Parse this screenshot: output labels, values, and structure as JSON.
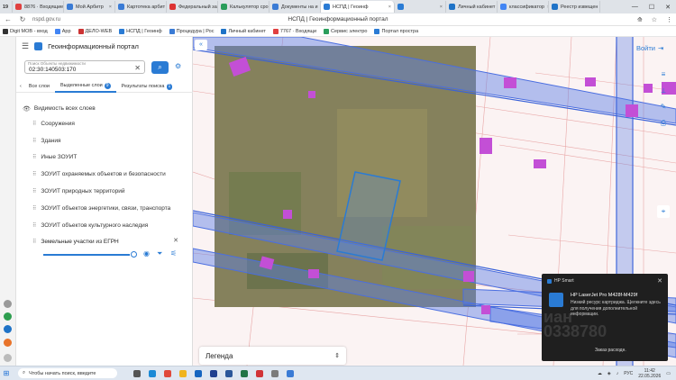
{
  "browser": {
    "tab_counter": "19",
    "tabs": [
      {
        "label": "8876 · Входящие",
        "color": "#e04040"
      },
      {
        "label": "Мой Арбитр",
        "color": "#3a7bd5"
      },
      {
        "label": "Картотека арбит",
        "color": "#3a7bd5"
      },
      {
        "label": "Федеральный зак",
        "color": "#d33"
      },
      {
        "label": "Калькулятор сро",
        "color": "#2a9d5b"
      },
      {
        "label": "Документы на и",
        "color": "#3a7bd5"
      },
      {
        "label": "НСПД | Геоинф",
        "color": "#2a7bd4",
        "active": true
      },
      {
        "label": "",
        "color": "#2a7bd4"
      },
      {
        "label": "Личный кабинет",
        "color": "#1f73c7"
      },
      {
        "label": "классификатор",
        "color": "#4285f4"
      },
      {
        "label": "Реестр извещен",
        "color": "#1f73c7"
      }
    ],
    "url": "nspd.gov.ru",
    "page_title": "НСПД | Геоинформационный портал",
    "bookmarks": [
      {
        "label": "Digit МОВ - вход",
        "color": "#333"
      },
      {
        "label": "Арр",
        "color": "#4285f4"
      },
      {
        "label": "ДЕЛО-WEB",
        "color": "#c33"
      },
      {
        "label": "НСПД | Геоинф",
        "color": "#2a7bd4"
      },
      {
        "label": "Процедура | Рос",
        "color": "#3a7bd5"
      },
      {
        "label": "Личный кабинет",
        "color": "#1f73c7"
      },
      {
        "label": "7767 · Входящи",
        "color": "#e04040"
      },
      {
        "label": "Сервис электро",
        "color": "#2a9d5b"
      },
      {
        "label": "Портал простра",
        "color": "#2a7bd4"
      }
    ]
  },
  "sidebar": {
    "title": "Геоинформационный портал",
    "search": {
      "placeholder": "Поиск Объекты недвижимости",
      "value": "02:30:140503:170"
    },
    "tabs": [
      {
        "label": "Все слои",
        "badge": ""
      },
      {
        "label": "Выделенные слои",
        "badge": "9"
      },
      {
        "label": "Результаты поиска",
        "badge": "1"
      }
    ],
    "visibility_all": "Видимость всех слоев",
    "layers": [
      "Сооружения",
      "Здания",
      "Иные ЗОУИТ",
      "ЗОУИТ охраняемых объектов и безопасности",
      "ЗОУИТ природных территорий",
      "ЗОУИТ объектов энергетики, связи, транспорта",
      "ЗОУИТ объектов культурного наследия"
    ],
    "expanded_layer": "Земельные участки из ЕГРН",
    "opacity_percent": 100
  },
  "map": {
    "login_label": "Войти",
    "legend_label": "Легенда",
    "toolbar_icons": [
      "layers-icon",
      "ruler-icon",
      "draw-icon",
      "print-icon",
      "locate-icon"
    ]
  },
  "toast": {
    "app": "HP Smart",
    "title": "HP LaserJet Pro M428f-M429f",
    "body": "Низкий ресурс картриджа. Щелкните здесь для получения дополнительной информации.",
    "action": "Заказ расходн.",
    "watermark": "иан\n0338780"
  },
  "taskbar": {
    "search_placeholder": "Чтобы начать поиск, введите",
    "lang": "РУС",
    "time": "11:42",
    "date": "22.05.2026"
  }
}
